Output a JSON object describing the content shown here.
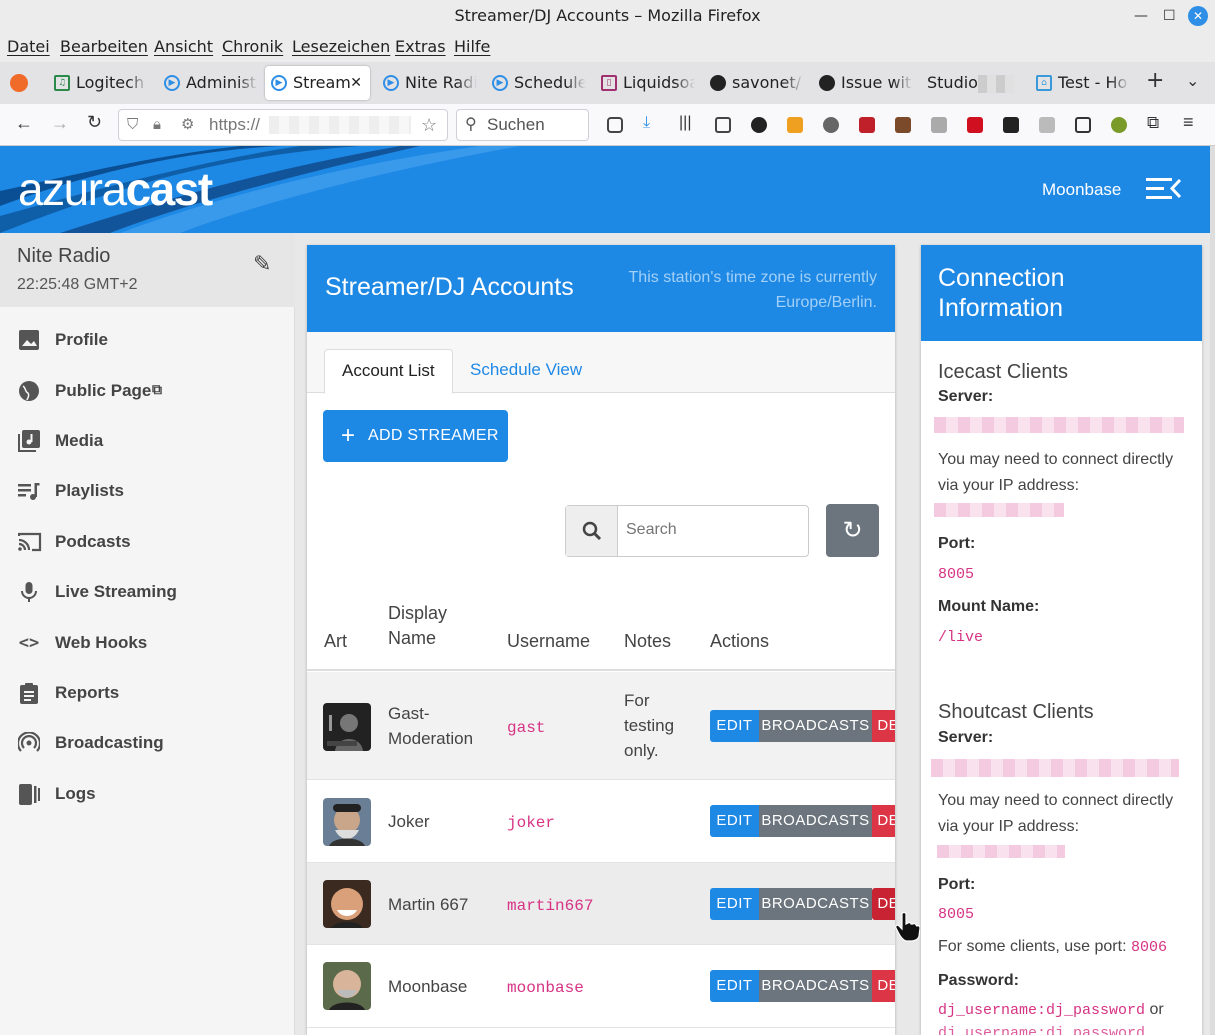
{
  "window": {
    "title": "Streamer/DJ Accounts – Mozilla Firefox"
  },
  "menu": [
    "Datei",
    "Bearbeiten",
    "Ansicht",
    "Chronik",
    "Lesezeichen",
    "Extras",
    "Hilfe"
  ],
  "tabs": [
    "Logitech",
    "Administ",
    "Stream",
    "Nite Radi",
    "Schedule",
    "Liquidsoa",
    "savonet/",
    "Issue wit",
    "Studio",
    "Test - Ho"
  ],
  "url": {
    "text": "https://"
  },
  "search": {
    "placeholder": "Suchen"
  },
  "header": {
    "logo_light": "azura",
    "logo_bold": "cast",
    "station": "Moonbase"
  },
  "sidebar": {
    "station_name": "Nite Radio",
    "time": "22:25:48 GMT+2",
    "items": [
      {
        "label": "Profile",
        "icon": "image-icon"
      },
      {
        "label": "Public Page",
        "icon": "globe-icon"
      },
      {
        "label": "Media",
        "icon": "library-music-icon"
      },
      {
        "label": "Playlists",
        "icon": "queue-music-icon"
      },
      {
        "label": "Podcasts",
        "icon": "cast-icon"
      },
      {
        "label": "Live Streaming",
        "icon": "mic-icon"
      },
      {
        "label": "Web Hooks",
        "icon": "code-icon"
      },
      {
        "label": "Reports",
        "icon": "clipboard-icon"
      },
      {
        "label": "Broadcasting",
        "icon": "broadcast-icon"
      },
      {
        "label": "Logs",
        "icon": "logs-icon"
      }
    ]
  },
  "main": {
    "title": "Streamer/DJ Accounts",
    "tz_note": "This station's time zone is currently Europe/Berlin.",
    "tabs": [
      "Account List",
      "Schedule View"
    ],
    "add_button": "ADD STREAMER",
    "search_placeholder": "Search",
    "columns": [
      "Art",
      "Display Name",
      "Username",
      "Notes",
      "Actions"
    ],
    "rows": [
      {
        "display": "Gast-Moderation",
        "username": "gast",
        "notes": "For testing only."
      },
      {
        "display": "Joker",
        "username": "joker",
        "notes": ""
      },
      {
        "display": "Martin 667",
        "username": "martin667",
        "notes": ""
      },
      {
        "display": "Moonbase",
        "username": "moonbase",
        "notes": ""
      }
    ],
    "actions": {
      "edit": "EDIT",
      "broadcasts": "BROADCASTS",
      "delete": "DELETE"
    }
  },
  "connection": {
    "title": "Connection Information",
    "icecast": {
      "heading": "Icecast Clients",
      "server_label": "Server:",
      "ip_note": "You may need to connect directly via your IP address:",
      "port_label": "Port:",
      "port": "8005",
      "mount_label": "Mount Name:",
      "mount": "/live"
    },
    "shoutcast": {
      "heading": "Shoutcast Clients",
      "server_label": "Server:",
      "ip_note": "You may need to connect directly via your IP address:",
      "port_label": "Port:",
      "port": "8005",
      "alt_port_note": "For some clients, use port:",
      "alt_port": "8006",
      "password_label": "Password:",
      "password_value": "dj_username:dj_password",
      "or": "or"
    }
  },
  "colors": {
    "primary": "#1e88e5",
    "secondary": "#6c757d",
    "danger": "#dc3545",
    "code": "#d63384"
  }
}
